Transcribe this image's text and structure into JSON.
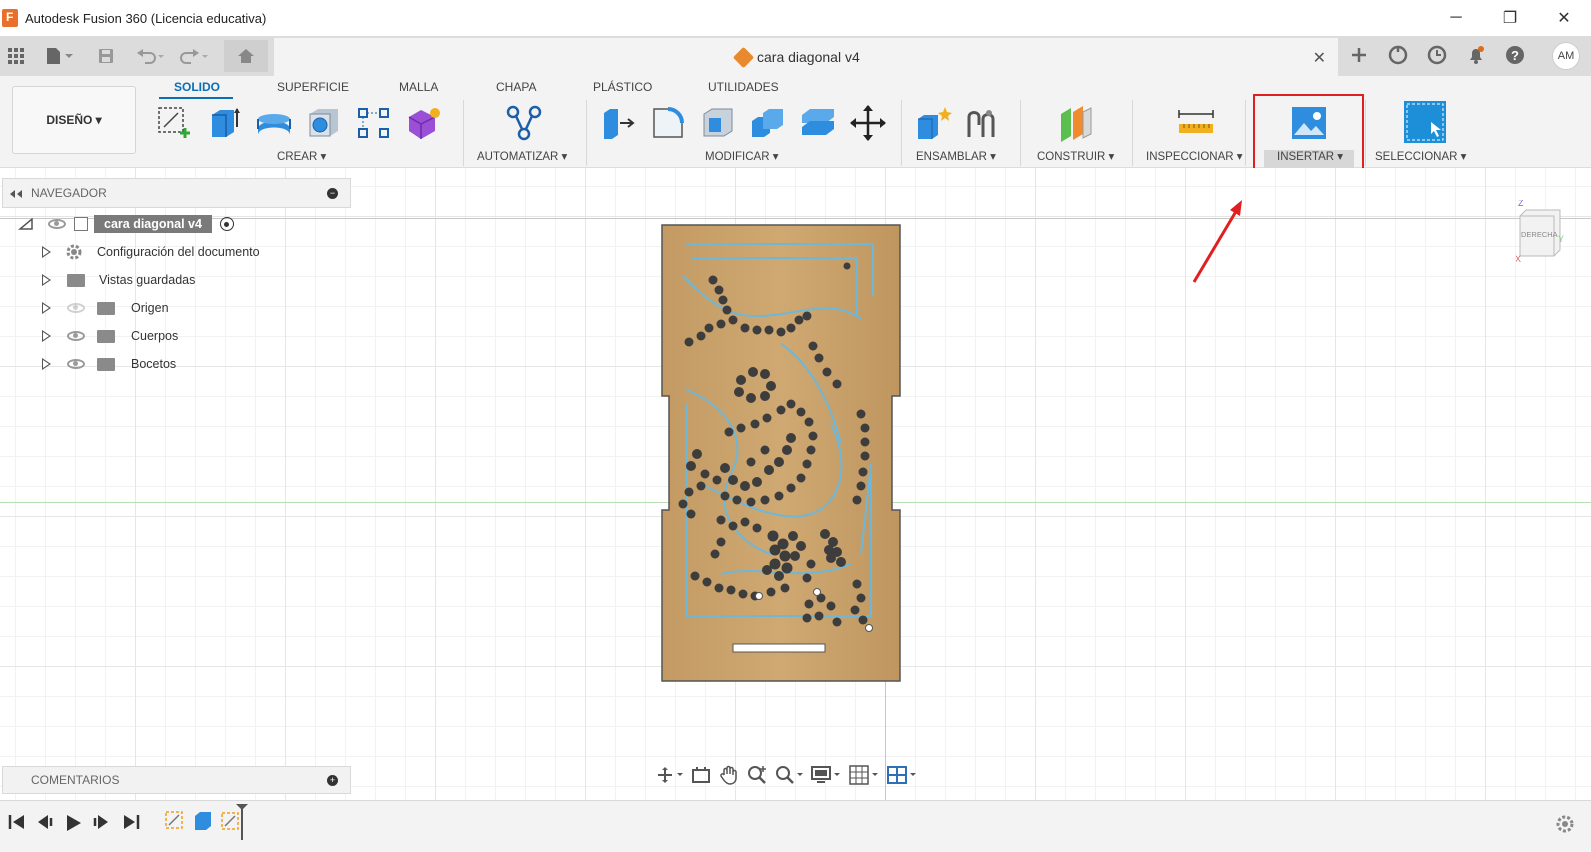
{
  "window": {
    "title": "Autodesk Fusion 360 (Licencia educativa)",
    "minimize": "─",
    "restore": "❐",
    "close": "✕"
  },
  "doc_tab": {
    "title": "cara diagonal v4",
    "close": "✕"
  },
  "user": {
    "initials": "AM"
  },
  "workspace": {
    "label": "DISEÑO ▾"
  },
  "ribbon_tabs": [
    "SOLIDO",
    "SUPERFICIE",
    "MALLA",
    "CHAPA",
    "PLÁSTICO",
    "UTILIDADES"
  ],
  "ribbon_groups": {
    "crear": "CREAR ▾",
    "automatizar": "AUTOMATIZAR ▾",
    "modificar": "MODIFICAR ▾",
    "ensamblar": "ENSAMBLAR ▾",
    "construir": "CONSTRUIR ▾",
    "inspeccionar": "INSPECCIONAR ▾",
    "insertar": "INSERTAR ▾",
    "seleccionar": "SELECCIONAR ▾"
  },
  "browser": {
    "title": "NAVEGADOR",
    "root": "cara diagonal v4",
    "items": [
      {
        "label": "Configuración del documento",
        "icon": "gear-icon"
      },
      {
        "label": "Vistas guardadas",
        "icon": "folder-icon"
      },
      {
        "label": "Origen",
        "icon": "folder-icon"
      },
      {
        "label": "Cuerpos",
        "icon": "folder-icon"
      },
      {
        "label": "Bocetos",
        "icon": "folder-icon"
      }
    ]
  },
  "comments": {
    "title": "COMENTARIOS"
  },
  "viewcube": {
    "face": "DERECHA",
    "axis_z": "Z",
    "axis_y": "Y",
    "axis_x": "X"
  },
  "colors": {
    "accent": "#0a6fb5",
    "highlight_box": "#e02020",
    "board": "#c9a36d",
    "sketch_line": "#6fb7d8"
  }
}
